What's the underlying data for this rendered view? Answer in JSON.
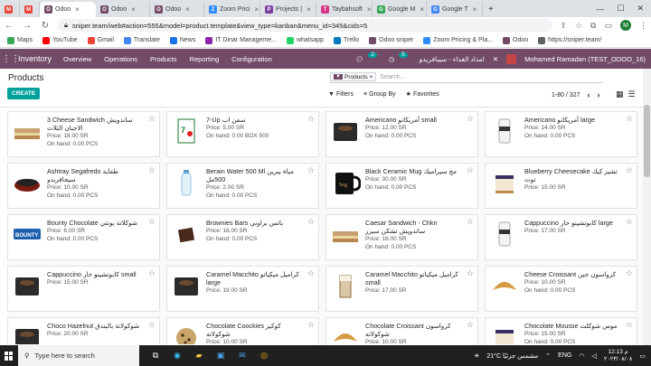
{
  "browser": {
    "tabs": [
      {
        "label": "",
        "icon": "gmail-icon",
        "color": "#ea4335",
        "glyph": "M"
      },
      {
        "label": "",
        "icon": "gmail-icon",
        "color": "#ea4335",
        "glyph": "M"
      },
      {
        "label": "Odoo",
        "icon": "odoo-icon",
        "color": "#714b67",
        "glyph": "O",
        "active": true
      },
      {
        "label": "Odoo",
        "icon": "odoo-icon",
        "color": "#714b67",
        "glyph": "O"
      },
      {
        "label": "Odoo",
        "icon": "odoo-icon",
        "color": "#714b67",
        "glyph": "O"
      },
      {
        "label": "Zoom Prici",
        "icon": "zoom-icon",
        "color": "#2d8cff",
        "glyph": "Z"
      },
      {
        "label": "Projects |",
        "icon": "projects-icon",
        "color": "#7b3fa0",
        "glyph": "P"
      },
      {
        "label": "Taybahsoft",
        "icon": "taybah-icon",
        "color": "#d63384",
        "glyph": "T"
      },
      {
        "label": "Google M",
        "icon": "maps-icon",
        "color": "#34a853",
        "glyph": "G"
      },
      {
        "label": "Google T",
        "icon": "translate-icon",
        "color": "#4285f4",
        "glyph": "G"
      }
    ],
    "url": "sniper.team/web#action=555&model=product.template&view_type=kanban&menu_id=345&cids=5",
    "profile_initial": "M",
    "bookmarks": [
      {
        "label": "Maps",
        "color": "#34a853"
      },
      {
        "label": "YouTube",
        "color": "#ff0000"
      },
      {
        "label": "Gmail",
        "color": "#ea4335"
      },
      {
        "label": "Translate",
        "color": "#4285f4"
      },
      {
        "label": "News",
        "color": "#1a73e8"
      },
      {
        "label": "IT Dinar Manageme...",
        "color": "#8e24aa"
      },
      {
        "label": "whatsapp",
        "color": "#25d366"
      },
      {
        "label": "Trello",
        "color": "#0079bf"
      },
      {
        "label": "Odoo sniper",
        "color": "#714b67"
      },
      {
        "label": "Zoom Pricing & Pla...",
        "color": "#2d8cff"
      },
      {
        "label": "Odoo",
        "color": "#714b67"
      },
      {
        "label": "https://sniper.team/",
        "color": "#5f6368"
      }
    ]
  },
  "odoo": {
    "app_name": "Inventory",
    "menu": [
      "Overview",
      "Operations",
      "Products",
      "Reporting",
      "Configuration"
    ],
    "chat_badge": "2",
    "activity_badge": "5",
    "company": "امداد الغذاء - سيبافريدو",
    "user": "Mohamed Ramadan (TEST_ODOO_16)"
  },
  "control_panel": {
    "breadcrumb": "Products",
    "create_label": "CREATE",
    "facet_label": "Products",
    "search_placeholder": "Search...",
    "filters_label": "Filters",
    "groupby_label": "Group By",
    "favorites_label": "Favorites",
    "pager": "1-80 / 327"
  },
  "products": [
    {
      "name": "3 Cheese Sandwich ساندويش الاجبان الثلاث",
      "price": "Price: 18.00 SR",
      "onhand": "On hand: 0.00 PCS",
      "thumb": "sandwich"
    },
    {
      "name": "7-Up سفن اب",
      "price": "Price: 5.00 SR",
      "onhand": "On hand: 0.00 BOX 500",
      "thumb": "sevenup"
    },
    {
      "name": "Americano أمريكانو small",
      "price": "Price: 12.00 SR",
      "onhand": "On hand: 0.00 PCS",
      "thumb": "cup-dark"
    },
    {
      "name": "Americano أمريكانو large",
      "price": "Price: 14.00 SR",
      "onhand": "On hand: 0.00 PCS",
      "thumb": "cup-tall"
    },
    {
      "name": "Ashtray Segafredo طفاية سيجافريدو",
      "price": "Price: 10.00 SR",
      "onhand": "On hand: 0.00 PCS",
      "thumb": "ashtray"
    },
    {
      "name": "Berain Water 500 Ml مياة بيرين 500مل",
      "price": "Price: 2.00 SR",
      "onhand": "On hand: 0.00 PCS",
      "thumb": "bottle"
    },
    {
      "name": "Black Ceramic Mug مج سيراميك",
      "price": "Price: 30.00 SR",
      "onhand": "On hand: 0.00 PCS",
      "thumb": "mug"
    },
    {
      "name": "Blueberry Cheesecake تشيز كيك توت",
      "price": "Price: 15.00 SR",
      "onhand": "",
      "thumb": "cake"
    },
    {
      "name": "Bounty Chocolate شوكلاتة بونتي",
      "price": "Price: 6.00 SR",
      "onhand": "On hand: 0.00 PCS",
      "thumb": "bounty"
    },
    {
      "name": "Brownies Bars باتس براوني",
      "price": "Price: 16.00 SR",
      "onhand": "On hand: 0.00 PCS",
      "thumb": "brownie"
    },
    {
      "name": "Caesar Sandwich - Chkn ساندويش تشكن سيزر",
      "price": "Price: 18.00 SR",
      "onhand": "On hand: 0.00 PCS",
      "thumb": "sandwich"
    },
    {
      "name": "Cappuccino كابوتشينو حار large",
      "price": "Price: 17.00 SR",
      "onhand": "",
      "thumb": "cup-tall"
    },
    {
      "name": "Cappuccino كابوتشينو حار small",
      "price": "Price: 15.00 SR",
      "onhand": "",
      "thumb": "cup-dark"
    },
    {
      "name": "Caramel Macchito كراميل ميكياتو large",
      "price": "Price: 19.00 SR",
      "onhand": "",
      "thumb": "cup-dark"
    },
    {
      "name": "Caramel Macchito كراميل ميكياتو small",
      "price": "Price: 17.00 SR",
      "onhand": "",
      "thumb": "glass"
    },
    {
      "name": "Cheese Croissant كرواسون جبن",
      "price": "Price: 10.00 SR",
      "onhand": "On hand: 0.00 PCS",
      "thumb": "croissant"
    },
    {
      "name": "Choco Hazelnut شوكولاتة بالبندق",
      "price": "Price: 20.00 SR",
      "onhand": "",
      "thumb": "cup-dark"
    },
    {
      "name": "Chocolate Coockies كوكيز شوكولاته",
      "price": "Price: 10.00 SR",
      "onhand": "On hand: 0.00 PCS",
      "thumb": "cookie"
    },
    {
      "name": "Chocolate Croissant كرواسون شوكولاته",
      "price": "Price: 10.00 SR",
      "onhand": "On hand: 0.00 PCS",
      "thumb": "croissant"
    },
    {
      "name": "Chocolate Mousse موس شوكلت",
      "price": "Price: 15.00 SR",
      "onhand": "On hand: 0.00 PCS",
      "thumb": "cake"
    }
  ],
  "taskbar": {
    "search_placeholder": "Type here to search",
    "weather": "21°C مشمس جزئيًا",
    "language": "ENG",
    "time": "12:13 م",
    "date": "٢٠٢٣/٠٨/٠٨"
  }
}
